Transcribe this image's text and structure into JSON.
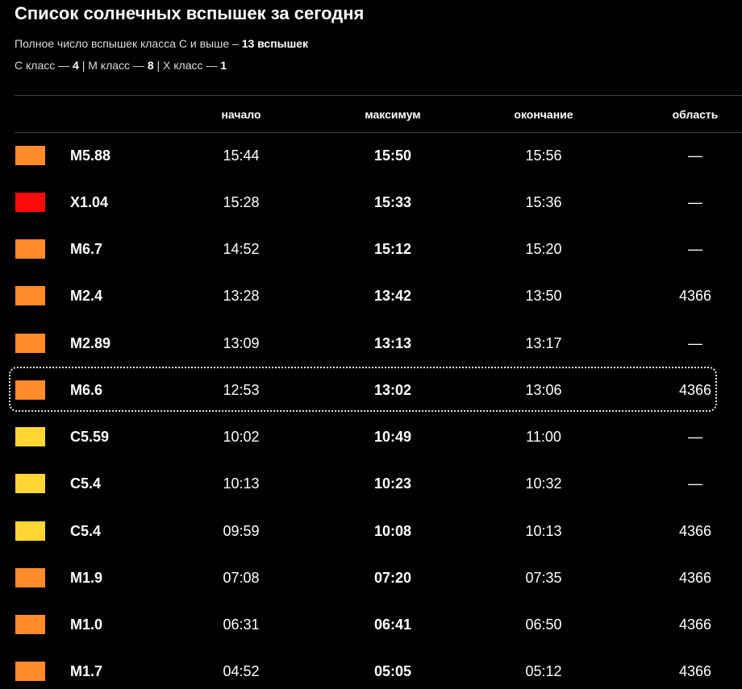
{
  "title": "Список солнечных вспышек за сегодня",
  "summary": {
    "prefix": "Полное число вспышек класса C и выше –",
    "total": "13 вспышек"
  },
  "breakdown": {
    "c_label": "C класс —",
    "c_count": "4",
    "sep1": "|",
    "m_label": "M класс —",
    "m_count": "8",
    "sep2": "|",
    "x_label": "X класс —",
    "x_count": "1"
  },
  "columns": {
    "start": "начало",
    "peak": "максимум",
    "end": "окончание",
    "region": "область"
  },
  "colors": {
    "C": "#ffd633",
    "M": "#ff8c2a",
    "X": "#ff0a0a"
  },
  "flares": [
    {
      "class": "M5.88",
      "color": "#ff8c2a",
      "start": "15:44",
      "peak": "15:50",
      "end": "15:56",
      "region": "—"
    },
    {
      "class": "X1.04",
      "color": "#ff0a0a",
      "start": "15:28",
      "peak": "15:33",
      "end": "15:36",
      "region": "—"
    },
    {
      "class": "M6.7",
      "color": "#ff8c2a",
      "start": "14:52",
      "peak": "15:12",
      "end": "15:20",
      "region": "—"
    },
    {
      "class": "M2.4",
      "color": "#ff8c2a",
      "start": "13:28",
      "peak": "13:42",
      "end": "13:50",
      "region": "4366"
    },
    {
      "class": "M2.89",
      "color": "#ff8c2a",
      "start": "13:09",
      "peak": "13:13",
      "end": "13:17",
      "region": "—"
    },
    {
      "class": "M6.6",
      "color": "#ff8c2a",
      "start": "12:53",
      "peak": "13:02",
      "end": "13:06",
      "region": "4366"
    },
    {
      "class": "C5.59",
      "color": "#ffd633",
      "start": "10:02",
      "peak": "10:49",
      "end": "11:00",
      "region": "—"
    },
    {
      "class": "C5.4",
      "color": "#ffd633",
      "start": "10:13",
      "peak": "10:23",
      "end": "10:32",
      "region": "—"
    },
    {
      "class": "C5.4",
      "color": "#ffd633",
      "start": "09:59",
      "peak": "10:08",
      "end": "10:13",
      "region": "4366"
    },
    {
      "class": "M1.9",
      "color": "#ff8c2a",
      "start": "07:08",
      "peak": "07:20",
      "end": "07:35",
      "region": "4366"
    },
    {
      "class": "M1.0",
      "color": "#ff8c2a",
      "start": "06:31",
      "peak": "06:41",
      "end": "06:50",
      "region": "4366"
    },
    {
      "class": "M1.7",
      "color": "#ff8c2a",
      "start": "04:52",
      "peak": "05:05",
      "end": "05:12",
      "region": "4366"
    }
  ]
}
